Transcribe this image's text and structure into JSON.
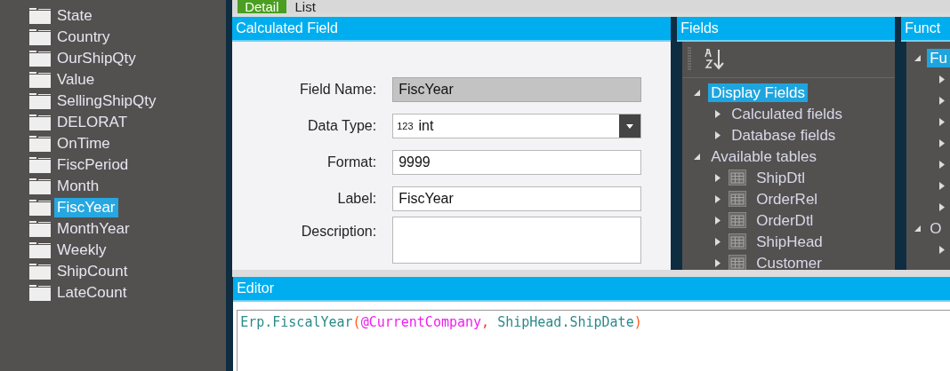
{
  "sidebar": {
    "items": [
      {
        "label": "State",
        "selected": false
      },
      {
        "label": "Country",
        "selected": false
      },
      {
        "label": "OurShipQty",
        "selected": false
      },
      {
        "label": "Value",
        "selected": false
      },
      {
        "label": "SellingShipQty",
        "selected": false
      },
      {
        "label": "DELORAT",
        "selected": false
      },
      {
        "label": "OnTime",
        "selected": false
      },
      {
        "label": "FiscPeriod",
        "selected": false
      },
      {
        "label": "Month",
        "selected": false
      },
      {
        "label": "FiscYear",
        "selected": true
      },
      {
        "label": "MonthYear",
        "selected": false
      },
      {
        "label": "Weekly",
        "selected": false
      },
      {
        "label": "ShipCount",
        "selected": false
      },
      {
        "label": "LateCount",
        "selected": false
      }
    ]
  },
  "tabs": [
    {
      "label": "Detail",
      "selected": true
    },
    {
      "label": "List",
      "selected": false
    }
  ],
  "calculated_field": {
    "title": "Calculated Field",
    "fields": [
      {
        "label": "Field Name:",
        "kind": "readonly",
        "value": "FiscYear"
      },
      {
        "label": "Data Type:",
        "kind": "dropdown",
        "type_badge": "123",
        "value": "int"
      },
      {
        "label": "Format:",
        "kind": "text",
        "value": "9999"
      },
      {
        "label": "Label:",
        "kind": "text",
        "value": "FiscYear"
      },
      {
        "label": "Description:",
        "kind": "multiline"
      }
    ]
  },
  "fields_panel": {
    "title": "Fields",
    "tree": [
      {
        "label": "Display Fields",
        "expanded": true,
        "selected": true,
        "children": [
          {
            "label": "Calculated fields",
            "expanded": false,
            "selected": false
          },
          {
            "label": "Database fields",
            "expanded": false,
            "selected": false
          }
        ]
      },
      {
        "label": "Available tables",
        "expanded": true,
        "selected": false,
        "children": [
          {
            "label": "ShipDtl",
            "kind": "table",
            "expanded": false,
            "selected": false
          },
          {
            "label": "OrderRel",
            "kind": "table",
            "expanded": false,
            "selected": false
          },
          {
            "label": "OrderDtl",
            "kind": "table",
            "expanded": false,
            "selected": false
          },
          {
            "label": "ShipHead",
            "kind": "table",
            "expanded": false,
            "selected": false
          },
          {
            "label": "Customer",
            "kind": "table",
            "expanded": false,
            "selected": false
          }
        ]
      }
    ]
  },
  "functions_panel": {
    "title": "Funct",
    "tree": [
      {
        "label": "Fu",
        "expanded": true,
        "selected": true,
        "children": [
          {
            "expanded": false
          },
          {
            "expanded": false
          },
          {
            "expanded": false
          },
          {
            "expanded": false
          },
          {
            "expanded": false
          },
          {
            "expanded": false
          },
          {
            "expanded": false
          }
        ]
      },
      {
        "label": "O",
        "expanded": true,
        "selected": false,
        "children": [
          {
            "expanded": false
          }
        ]
      }
    ]
  },
  "editor": {
    "title": "Editor",
    "tokens": [
      {
        "text": "Erp.FiscalYear",
        "kind": "identifier"
      },
      {
        "text": "(",
        "kind": "paren"
      },
      {
        "text": "@CurrentCompany",
        "kind": "parameter"
      },
      {
        "text": ",",
        "kind": "punctuation"
      },
      {
        "text": " ShipHead.ShipDate",
        "kind": "identifier"
      },
      {
        "text": ")",
        "kind": "paren"
      }
    ]
  }
}
